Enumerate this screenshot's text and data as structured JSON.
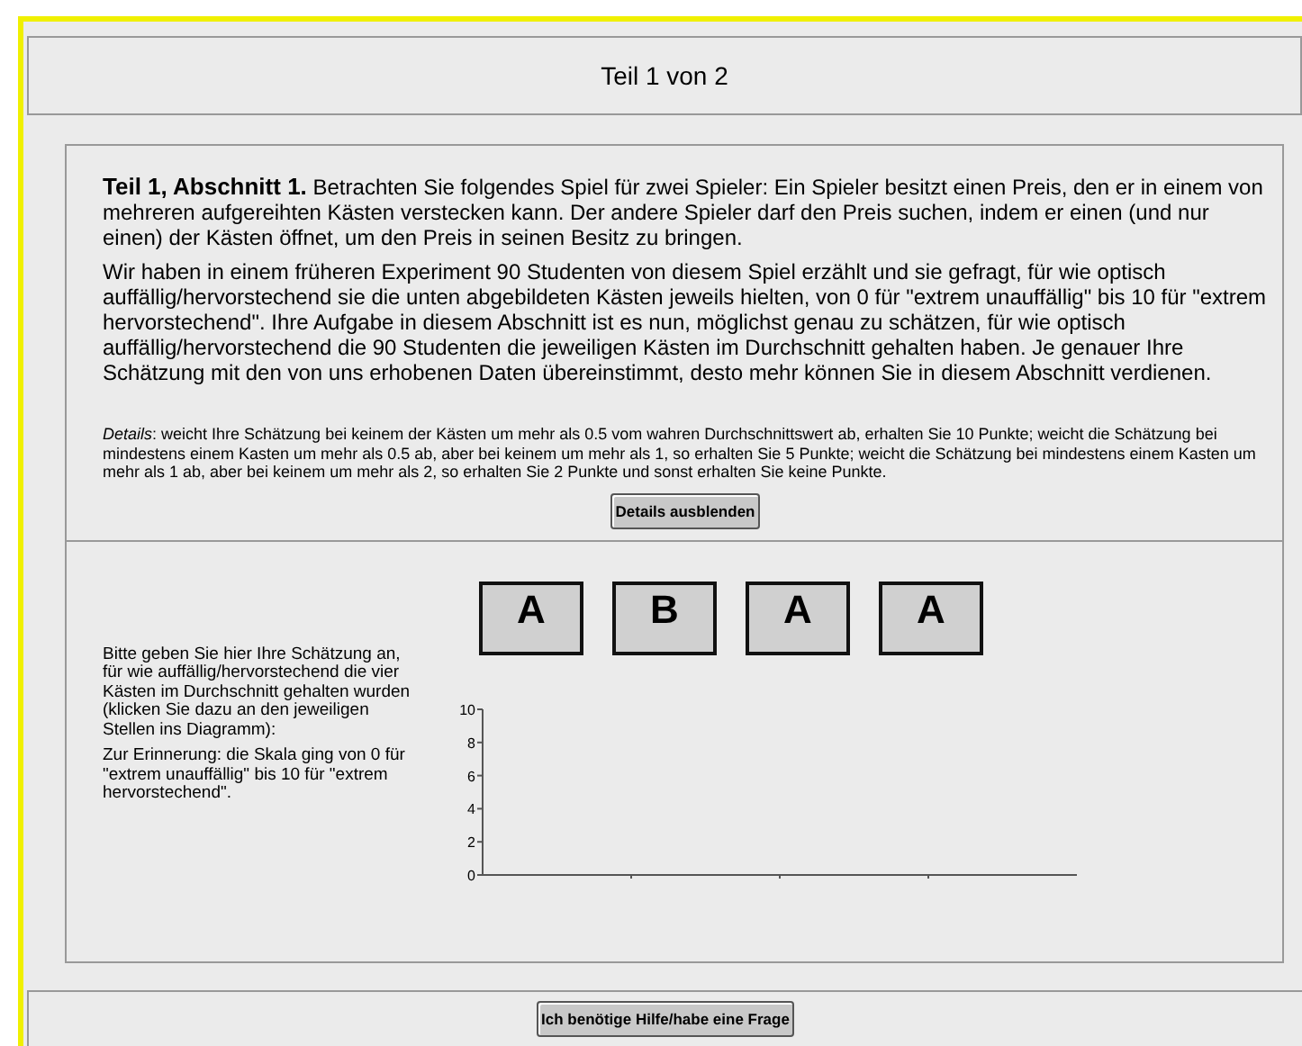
{
  "header": {
    "title": "Teil 1 von 2"
  },
  "intro": {
    "heading": "Teil 1, Abschnitt 1.",
    "paragraphs": [
      "Betrachten Sie folgendes Spiel für zwei Spieler: Ein Spieler besitzt einen Preis, den er in einem von mehreren aufgereihten Kästen verstecken kann. Der andere Spieler darf den Preis suchen, indem er einen (und nur einen) der Kästen öffnet, um den Preis in seinen Besitz zu bringen.",
      "Wir haben in einem früheren Experiment 90 Studenten von diesem Spiel erzählt und sie gefragt, für wie optisch auffällig/hervorstechend sie die unten abgebildeten Kästen jeweils hielten, von 0 für \"extrem unauffällig\" bis 10 für \"extrem hervorstechend\". Ihre Aufgabe in diesem Abschnitt ist es nun, möglichst genau zu schätzen, für wie optisch auffällig/hervorstechend die 90 Studenten die jeweiligen Kästen im Durchschnitt gehalten haben. Je genauer Ihre Schätzung mit den von uns erhobenen Daten übereinstimmt, desto mehr können Sie in diesem Abschnitt verdienen."
    ],
    "details": "*Details*: weicht Ihre Schätzung bei keinem der Kästen um mehr als 0.5 vom wahren Durchschnittswert ab, erhalten Sie 10 Punkte; weicht die Schätzung bei mindestens einem Kasten um mehr als 0.5 ab, aber bei keinem um mehr als 1, so erhalten Sie 5 Punkte; weicht die Schätzung bei mindestens einem Kasten um mehr als 1 ab, aber bei keinem um mehr als 2, so erhalten Sie 2 Punkte und sonst erhalten Sie keine Punkte.",
    "details_button": "Details ausblenden"
  },
  "estimate": {
    "instructions": [
      "Bitte geben Sie hier Ihre Schätzung an, für wie auffällig/hervorstechend die vier Kästen im Durchschnitt gehalten wurden (klicken Sie dazu an den jeweiligen Stellen ins Diagramm):",
      "Zur Erinnerung: die Skala ging von 0 für \"extrem unauffällig\" bis 10 für \"extrem hervorstechend\"."
    ],
    "boxes": [
      {
        "label": "A"
      },
      {
        "label": "B"
      },
      {
        "label": "A"
      },
      {
        "label": "A"
      }
    ],
    "chart_data": {
      "type": "bar",
      "values": [
        null,
        null,
        null,
        null
      ],
      "ylim": [
        0,
        10
      ],
      "yticks": [
        0,
        2,
        4,
        6,
        8,
        10
      ]
    }
  },
  "footer": {
    "help_button": "Ich benötige Hilfe/habe eine Frage"
  }
}
